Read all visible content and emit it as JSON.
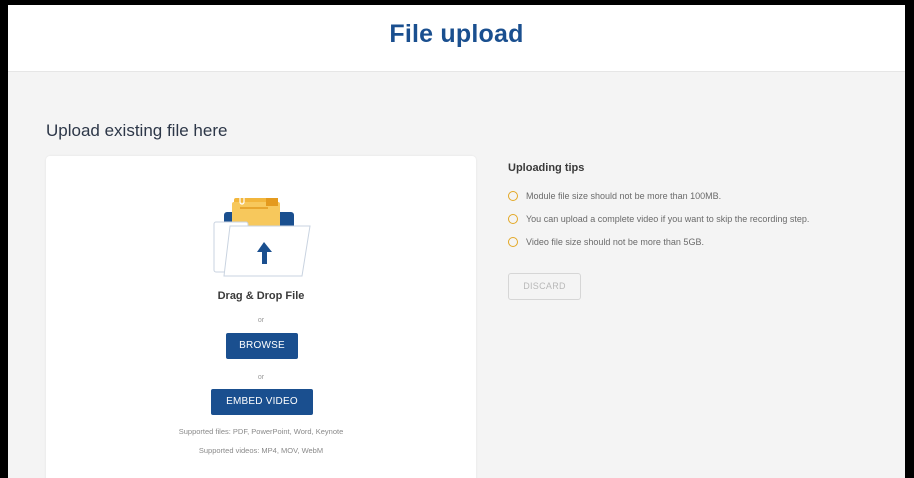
{
  "header": {
    "title": "File upload"
  },
  "upload": {
    "section_title": "Upload existing file here",
    "drag_drop_label": "Drag & Drop File",
    "or_1": "or",
    "browse_label": "BROWSE",
    "or_2": "or",
    "embed_label": "EMBED VIDEO",
    "supported_files": "Supported files: PDF, PowerPoint, Word, Keynote",
    "supported_videos": "Supported videos: MP4, MOV, WebM",
    "illustration_icon": "folder-upload-icon"
  },
  "tips": {
    "title": "Uploading tips",
    "items": [
      {
        "text": "Module file size should not be more than 100MB."
      },
      {
        "text": "You can upload a complete video if you want to skip the recording step."
      },
      {
        "text": "Video file size should not be more than 5GB."
      }
    ],
    "marker_color": "#e3a826"
  },
  "actions": {
    "discard_label": "DISCARD"
  },
  "colors": {
    "brand": "#1a4f8f",
    "background": "#f4f4f4",
    "folder_orange": "#f2b63c",
    "folder_blue": "#1a4f8f"
  }
}
